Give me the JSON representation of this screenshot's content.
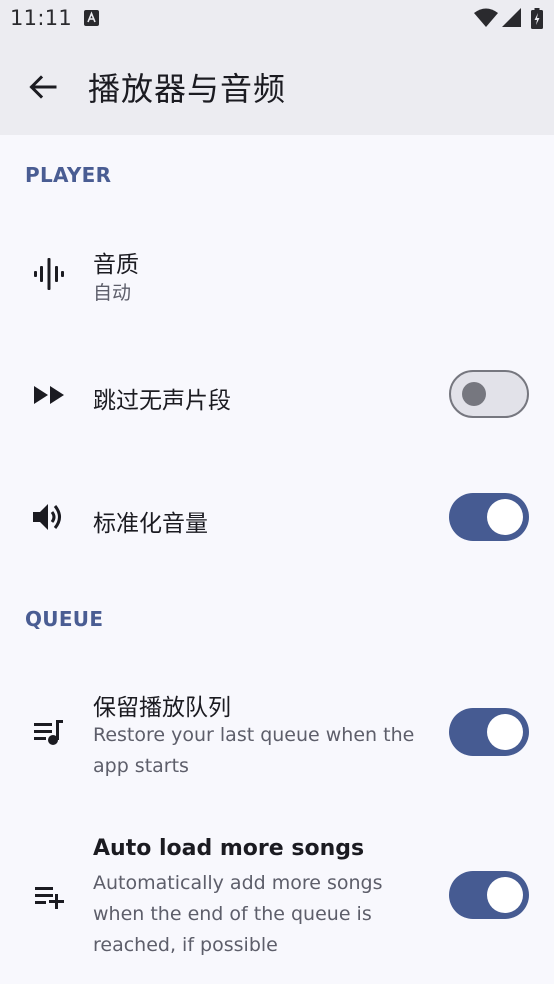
{
  "status_bar": {
    "time": "11:11"
  },
  "app_bar": {
    "title": "播放器与音频"
  },
  "sections": {
    "player": "PLAYER",
    "queue": "QUEUE"
  },
  "settings": {
    "audio_quality": {
      "title": "音质",
      "value": "自动",
      "icon": "waveform-icon"
    },
    "skip_silence": {
      "title": "跳过无声片段",
      "enabled": false,
      "icon": "fast-forward-icon"
    },
    "normalize_volume": {
      "title": "标准化音量",
      "enabled": true,
      "icon": "volume-icon"
    },
    "persistent_queue": {
      "title": "保留播放队列",
      "description": "Restore your last queue when the app starts",
      "enabled": true,
      "icon": "queue-music-icon"
    },
    "auto_load_more": {
      "title": "Auto load more songs",
      "description": "Automatically add more songs when the end of the queue is reached, if possible",
      "enabled": true,
      "icon": "playlist-add-icon"
    }
  },
  "colors": {
    "accent": "#465b92",
    "section": "#4a5d93",
    "background": "#f8f8fd",
    "app_bar": "#ececf1"
  }
}
